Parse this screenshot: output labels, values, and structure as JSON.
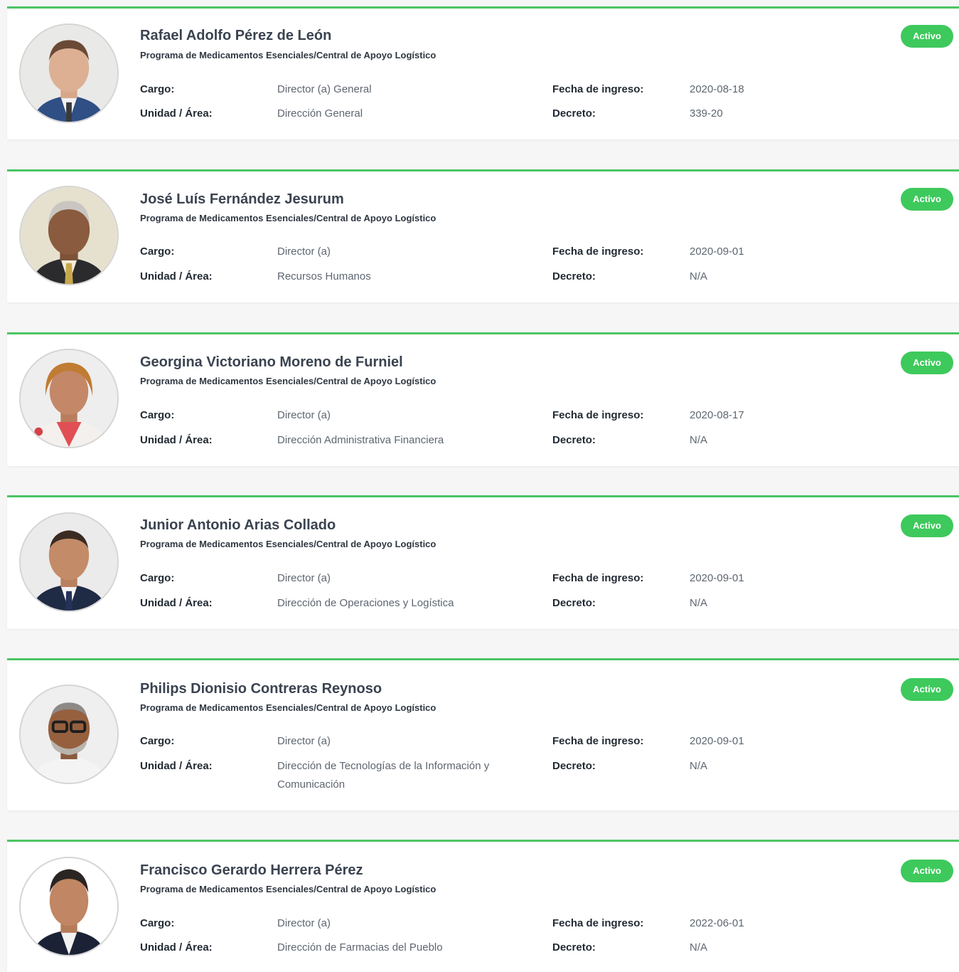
{
  "labels": {
    "cargo": "Cargo:",
    "unidad": "Unidad / Área:",
    "fecha": "Fecha de ingreso:",
    "decreto": "Decreto:"
  },
  "colors": {
    "accent": "#4bc563",
    "badge": "#3ec95c",
    "page_bg": "#f6f6f6"
  },
  "officials": [
    {
      "name": "Rafael Adolfo Pérez de León",
      "organization": "Programa de Medicamentos Esenciales/Central de Apoyo Logístico",
      "cargo": "Director (a) General",
      "unidad": "Dirección General",
      "fecha_ingreso": "2020-08-18",
      "decreto": "339-20",
      "status": "Activo"
    },
    {
      "name": "José Luís Fernández Jesurum",
      "organization": "Programa de Medicamentos Esenciales/Central de Apoyo Logístico",
      "cargo": "Director (a)",
      "unidad": "Recursos Humanos",
      "fecha_ingreso": "2020-09-01",
      "decreto": "N/A",
      "status": "Activo"
    },
    {
      "name": "Georgina Victoriano Moreno de Furniel",
      "organization": "Programa de Medicamentos Esenciales/Central de Apoyo Logístico",
      "cargo": "Director (a)",
      "unidad": "Dirección Administrativa Financiera",
      "fecha_ingreso": "2020-08-17",
      "decreto": "N/A",
      "status": "Activo"
    },
    {
      "name": "Junior Antonio Arias Collado",
      "organization": "Programa de Medicamentos Esenciales/Central de Apoyo Logístico",
      "cargo": "Director (a)",
      "unidad": "Dirección de Operaciones y Logística",
      "fecha_ingreso": "2020-09-01",
      "decreto": "N/A",
      "status": "Activo"
    },
    {
      "name": "Philips Dionisio Contreras Reynoso",
      "organization": "Programa de Medicamentos Esenciales/Central de Apoyo Logístico",
      "cargo": "Director (a)",
      "unidad": "Dirección de Tecnologías de la Información y Comunicación",
      "fecha_ingreso": "2020-09-01",
      "decreto": "N/A",
      "status": "Activo"
    },
    {
      "name": "Francisco Gerardo Herrera Pérez",
      "organization": "Programa de Medicamentos Esenciales/Central de Apoyo Logístico",
      "cargo": "Director (a)",
      "unidad": "Dirección de Farmacias del Pueblo",
      "fecha_ingreso": "2022-06-01",
      "decreto": "N/A",
      "status": "Activo"
    }
  ]
}
